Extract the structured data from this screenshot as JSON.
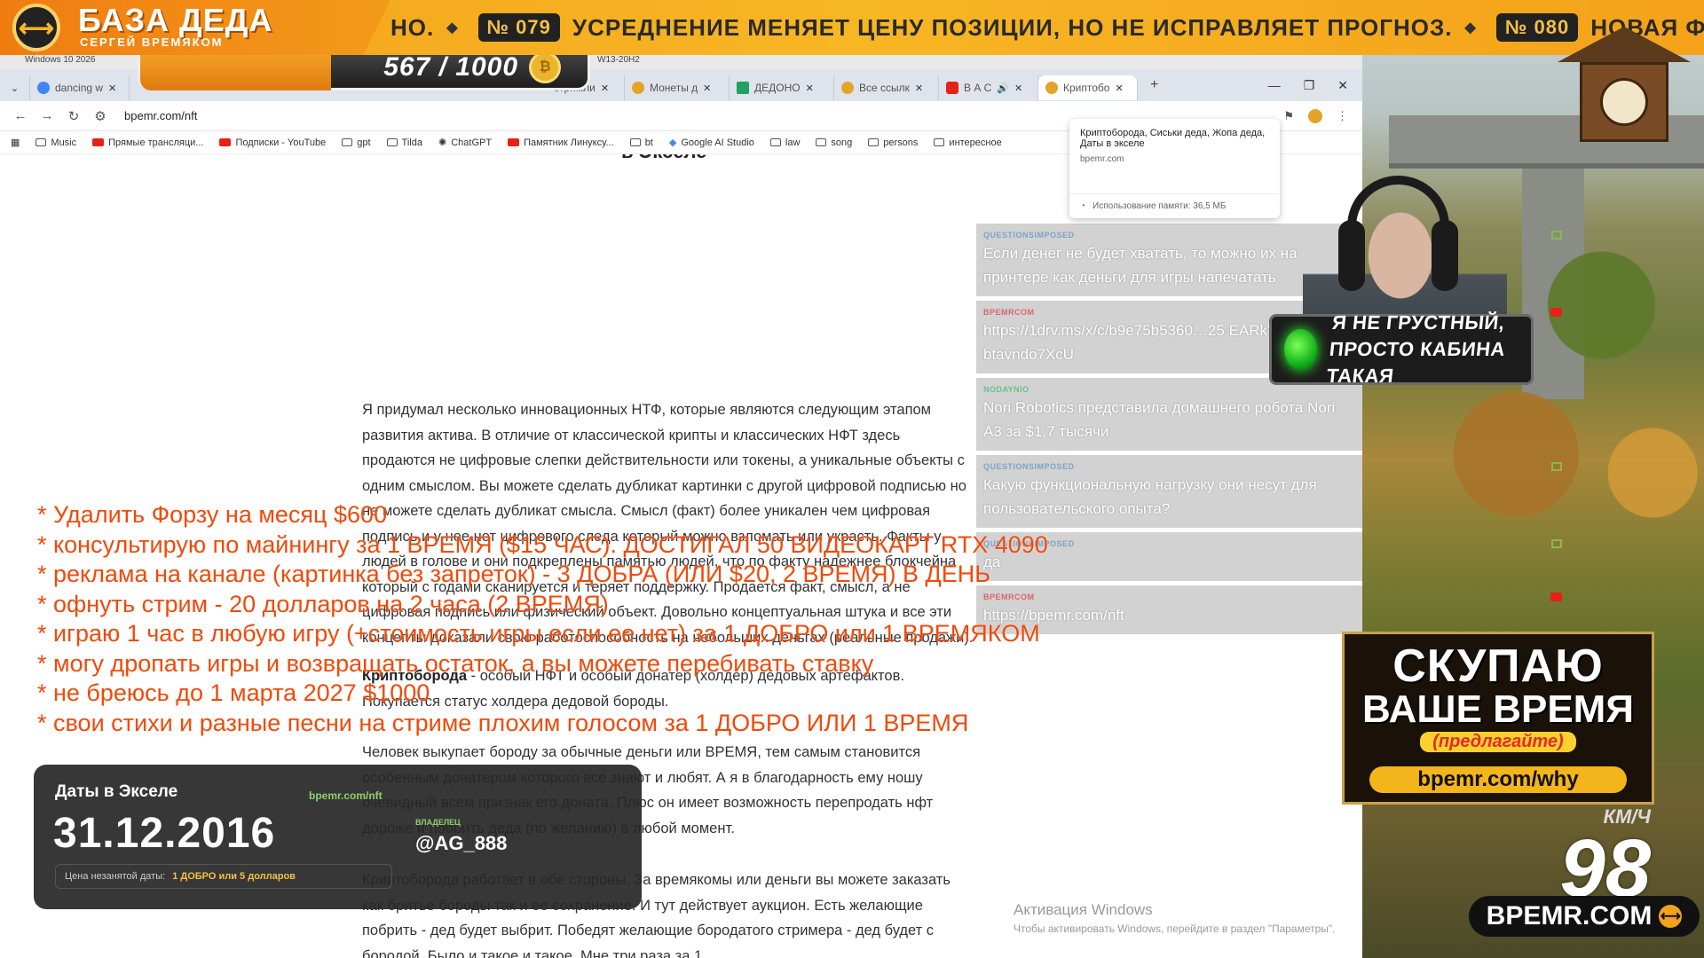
{
  "overlay": {
    "logo_title": "БАЗА ДЕДА",
    "logo_subtitle": "СЕРГЕЙ ВРЕМЯКОМ",
    "counter": "567 / 1000",
    "ticker": [
      {
        "num": "",
        "text": "НО."
      },
      {
        "num": "№ 079",
        "text": "УСРЕДНЕНИЕ МЕНЯЕТ ЦЕНУ ПОЗИЦИИ, НО НЕ ИСПРАВЛЯЕТ ПРОГНОЗ."
      },
      {
        "num": "№ 080",
        "text": "НОВАЯ ФИШКА"
      }
    ],
    "status_line1": "Я НЕ ГРУСТНЫЙ,",
    "status_line2": "ПРОСТО КАБИНА ТАКАЯ",
    "ad_line1": "СКУПАЮ",
    "ad_line2": "ВАШЕ ВРЕМЯ",
    "ad_line3": "(предлагайте)",
    "ad_url": "bpemr.com/why",
    "speed_unit": "КМ/Ч",
    "speed_value": "98",
    "brand": "BPEMR.COM"
  },
  "taskbar": {
    "left": "Windows 10 2026",
    "right": "W13-20H2"
  },
  "browser": {
    "tabs": [
      {
        "label": "dancing w"
      },
      {
        "label": "стримли"
      },
      {
        "label": "Монеты д"
      },
      {
        "label": "ДЕДОНО"
      },
      {
        "label": "Все ссылк"
      },
      {
        "label": "В А С"
      },
      {
        "label": "Криптобо",
        "active": true
      }
    ],
    "url": "bpemr.com/nft",
    "bookmarks": [
      "Music",
      "Прямые трансляци...",
      "Подписки - YouTube",
      "gpt",
      "Tilda",
      "ChatGPT",
      "Памятник Линуксу...",
      "bt",
      "Google AI Studio",
      "law",
      "song",
      "persons",
      "интересное"
    ],
    "hover": {
      "title": "Криптоборода, Сиськи деда, Жопа деда, Даты в экселе",
      "domain": "bpemr.com",
      "memory": "Использование памяти: 36,5 МБ"
    }
  },
  "page": {
    "title": "в Экселе",
    "p1": "Я придумал несколько инновационных НТФ, которые являются следующим этапом развития актива. В отличие от классической крипты и классических НФТ здесь продаются не цифровые слепки действительности или токены, а уникальные объекты с одним смыслом. Вы можете сделать дубликат картинки с другой цифровой подписью но не можете сделать дубликат смысла. Смысл (факт) более уникален чем цифровая подпись и у нее нет цифрового следа который можно взломать или украсть. Факты у людей в голове и они подкреплены памятью людей, что по факту надежнее блокчейна который с годами сканируется и теряет поддержку. Продается факт, смысл, а не цифровая подпись или физический объект. Довольно концептуальная штука и все эти концепты доказали свою работоспособность на небольших деньгах (реальные продажи).",
    "p2_bold": "Криптоборода",
    "p2": " - особый НФТ и особый донатер (холдер) дедовых артефактов. Покупается статус холдера дедовой бороды.",
    "p3": "Человек выкупает бороду за обычные деньги или ВРЕМЯ, тем самым становится особенным донатером которого все знают и любят. А я в благодарность ему ношу очевидный всем признак его доната. Плюс он имеет возможность перепродать нфт дороже и побрить деда (по желанию) в любой момент.",
    "p4": "Криптоборода работает в обе стороны. За времякомы или деньги вы можете заказать как бритье бороды так и ее сохранение. И тут действует аукцион. Есть желающие побрить - дед будет выбрит. Победят желающие бородатого стримера - дед будет с бородой. Было и такое и такое. Мне три раза за 1"
  },
  "chat": [
    {
      "name": "QUESTIONSIMPOSED",
      "text": "Если денег не будет хватать, то можно их на принтере как деньги для игры напечатать",
      "badge": "box"
    },
    {
      "name": "BPEMRCOM",
      "text": "https://1drv.ms/x/c/b9e75b5360…25 EARkVpsDQG7V-btavndo7XcU",
      "badge": "yt"
    },
    {
      "name": "NODAYNIO",
      "text": "Nori Robotics представила домашнего робота Nori A3 за $1,7 тысячи",
      "badge": "none"
    },
    {
      "name": "QUESTIONSIMPOSED",
      "text": "Какую функциональную нагрузку они несут для пользовательского опыта?",
      "badge": "box"
    },
    {
      "name": "QUESTIONSIMPOSED",
      "text": "да",
      "badge": "box"
    },
    {
      "name": "BPEMRCOM",
      "text": "https://bpemr.com/nft",
      "badge": "yt"
    }
  ],
  "offers": [
    "* Удалить Форзу на месяц $600",
    "* консультирую по майнингу за 1 ВРЕМЯ ($15 ЧАС). ДОСТИГАЛ 50 ВИДЕОКАРТ RTX 4090",
    "* реклама на канале (картинка без запреток) - 3 ДОБРА (ИЛИ $20, 2 ВРЕМЯ) В ДЕНЬ",
    "* офнуть стрим - 20 долларов на 2 часа (2 ВРЕМЯ)",
    "* играю 1 час в любую игру (+стоимость игры если ее нет) за 1 ДОБРО или 1 ВРЕМЯКОМ",
    "* могу дропать игры и возвращать остаток, а вы можете перебивать ставку",
    "* не бреюсь до 1 марта 2027 $1000",
    "* свои стихи и разные песни на стриме плохим голосом за 1 ДОБРО ИЛИ 1 ВРЕМЯ"
  ],
  "dates_card": {
    "heading": "Даты в Экселе",
    "source": "bpemr.com/nft",
    "date": "31.12.2016",
    "price_label": "Цена незанятой даты:",
    "price_value": "1 ДОБРО или 5 долларов",
    "owner_label": "ВЛАДЕЛЕЦ",
    "owner": "@AG_888"
  },
  "activation": {
    "title": "Активация Windows",
    "text": "Чтобы активировать Windows, перейдите в раздел \"Параметры\"."
  }
}
